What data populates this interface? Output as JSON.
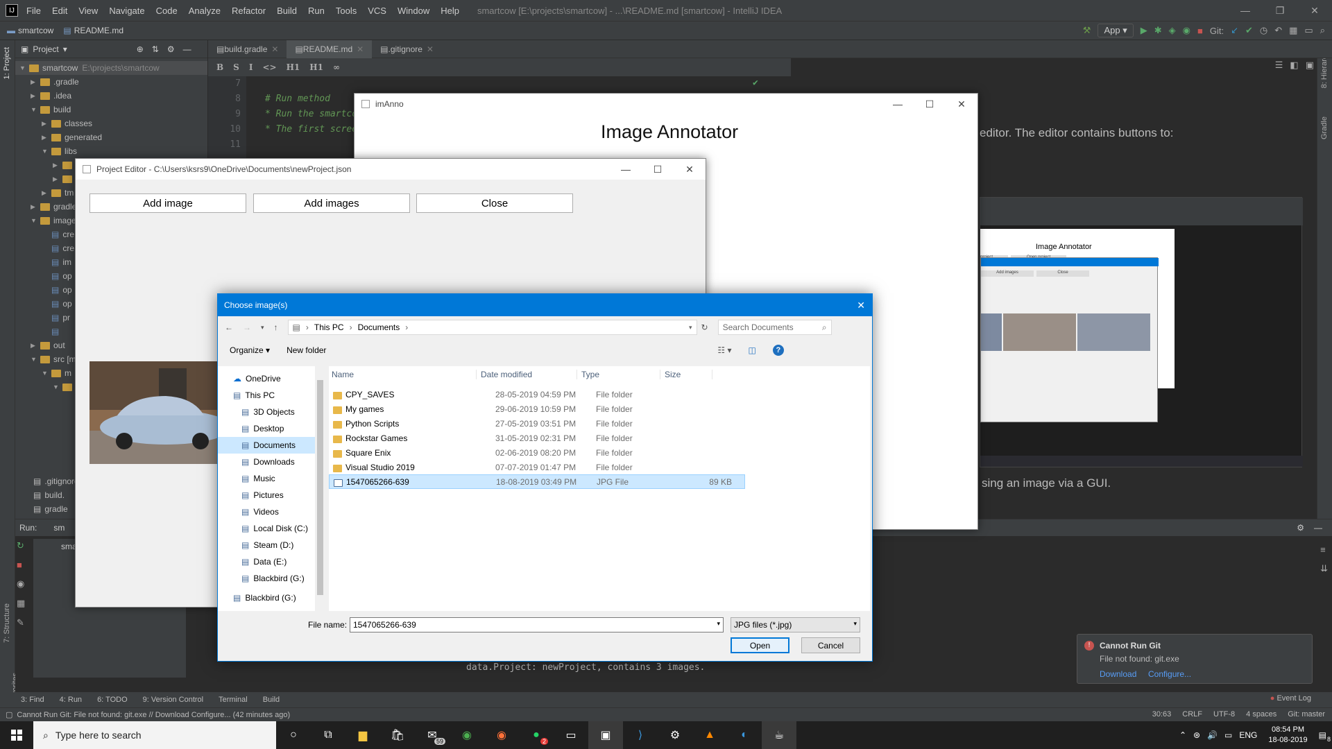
{
  "ide": {
    "menu": [
      "File",
      "Edit",
      "View",
      "Navigate",
      "Code",
      "Analyze",
      "Refactor",
      "Build",
      "Run",
      "Tools",
      "VCS",
      "Window",
      "Help"
    ],
    "window_title": "smartcow [E:\\projects\\smartcow] - ...\\README.md [smartcow] - IntelliJ IDEA",
    "breadcrumb": [
      "smartcow",
      "README.md"
    ],
    "run_config": "App",
    "git_label": "Git:",
    "project_panel_title": "Project",
    "tree": [
      {
        "label": "smartcow",
        "extra": "E:\\projects\\smartcow",
        "depth": 0,
        "open": true
      },
      {
        "label": ".gradle",
        "depth": 1,
        "open": false
      },
      {
        "label": ".idea",
        "depth": 1,
        "open": false
      },
      {
        "label": "build",
        "depth": 1,
        "open": true
      },
      {
        "label": "classes",
        "depth": 2,
        "open": false
      },
      {
        "label": "generated",
        "depth": 2,
        "open": false
      },
      {
        "label": "libs",
        "depth": 2,
        "open": true
      },
      {
        "label": "",
        "depth": 3,
        "open": false
      },
      {
        "label": "",
        "depth": 3,
        "open": false
      },
      {
        "label": "tm",
        "depth": 2,
        "open": false
      },
      {
        "label": "gradle",
        "depth": 1,
        "open": false
      },
      {
        "label": "image",
        "depth": 1,
        "open": true
      },
      {
        "label": "cre",
        "depth": 2,
        "file": true
      },
      {
        "label": "cre",
        "depth": 2,
        "file": true
      },
      {
        "label": "im",
        "depth": 2,
        "file": true
      },
      {
        "label": "op",
        "depth": 2,
        "file": true
      },
      {
        "label": "op",
        "depth": 2,
        "file": true
      },
      {
        "label": "op",
        "depth": 2,
        "file": true
      },
      {
        "label": "pr",
        "depth": 2,
        "file": true
      },
      {
        "label": "",
        "depth": 2,
        "file": true
      },
      {
        "label": "out",
        "depth": 1,
        "open": false
      },
      {
        "label": "src [m",
        "depth": 1,
        "open": true
      },
      {
        "label": "m",
        "depth": 2,
        "open": true
      },
      {
        "label": "",
        "depth": 3,
        "open": true
      }
    ],
    "tree_bottom": [
      ".gitignore",
      "build.",
      "gradle"
    ],
    "editor_tabs": [
      {
        "label": "build.gradle",
        "active": false
      },
      {
        "label": "README.md",
        "active": true
      },
      {
        "label": ".gitignore",
        "active": false
      }
    ],
    "md_toolbar": [
      "B",
      "S",
      "I",
      "<>",
      "H1",
      "H1",
      "∞"
    ],
    "code_lines": [
      {
        "num": "7",
        "text": ""
      },
      {
        "num": "8",
        "text": "# Run method"
      },
      {
        "num": "9",
        "text": "* Run the smartcow"
      },
      {
        "num": "10",
        "text": "* The first screen"
      },
      {
        "num": "11",
        "text": ""
      }
    ],
    "preview_text_1": "editor. The editor contains buttons to:",
    "preview_text_2": "sing an image via a GUI.",
    "run_label": "Run:",
    "run_tab": "sm",
    "run_item": "sma",
    "console_line": "data.Project: newProject, contains 3 images.",
    "bottom_tabs": [
      "3: Find",
      "4: Run",
      "6: TODO",
      "9: Version Control",
      "Terminal",
      "Build"
    ],
    "event_log": "Event Log",
    "status_msg": "Cannot Run Git: File not found: git.exe // Download   Configure... (42 minutes ago)",
    "status_right": [
      "30:63",
      "CRLF",
      "UTF-8",
      "4 spaces",
      "Git: master"
    ],
    "left_stripe": [
      "1: Project",
      "7: Structure",
      "2: Favorites"
    ],
    "right_stripe": [
      "8: Hierarchy",
      "Gradle"
    ]
  },
  "notification": {
    "title": "Cannot Run Git",
    "body": "File not found: git.exe",
    "links": [
      "Download",
      "Configure..."
    ]
  },
  "imanno": {
    "title": "imAnno",
    "heading": "Image Annotator"
  },
  "project_editor": {
    "title": "Project Editor - C:\\Users\\ksrs9\\OneDrive\\Documents\\newProject.json",
    "buttons": [
      "Add image",
      "Add images",
      "Close"
    ]
  },
  "dialog": {
    "title": "Choose image(s)",
    "path": [
      "This PC",
      "Documents"
    ],
    "search_placeholder": "Search Documents",
    "organize": "Organize",
    "new_folder": "New folder",
    "nav": [
      {
        "label": "OneDrive",
        "indent": 0
      },
      {
        "label": "This PC",
        "indent": 0
      },
      {
        "label": "3D Objects",
        "indent": 1
      },
      {
        "label": "Desktop",
        "indent": 1
      },
      {
        "label": "Documents",
        "indent": 1,
        "selected": true
      },
      {
        "label": "Downloads",
        "indent": 1
      },
      {
        "label": "Music",
        "indent": 1
      },
      {
        "label": "Pictures",
        "indent": 1
      },
      {
        "label": "Videos",
        "indent": 1
      },
      {
        "label": "Local Disk (C:)",
        "indent": 1
      },
      {
        "label": "Steam (D:)",
        "indent": 1
      },
      {
        "label": "Data (E:)",
        "indent": 1
      },
      {
        "label": "Blackbird (G:)",
        "indent": 1
      },
      {
        "label": "Blackbird (G:)",
        "indent": 0
      }
    ],
    "columns": [
      "Name",
      "Date modified",
      "Type",
      "Size"
    ],
    "files": [
      {
        "name": "CPY_SAVES",
        "date": "28-05-2019 04:59 PM",
        "type": "File folder",
        "size": ""
      },
      {
        "name": "My games",
        "date": "29-06-2019 10:59 PM",
        "type": "File folder",
        "size": ""
      },
      {
        "name": "Python Scripts",
        "date": "27-05-2019 03:51 PM",
        "type": "File folder",
        "size": ""
      },
      {
        "name": "Rockstar Games",
        "date": "31-05-2019 02:31 PM",
        "type": "File folder",
        "size": ""
      },
      {
        "name": "Square Enix",
        "date": "02-06-2019 08:20 PM",
        "type": "File folder",
        "size": ""
      },
      {
        "name": "Visual Studio 2019",
        "date": "07-07-2019 01:47 PM",
        "type": "File folder",
        "size": ""
      },
      {
        "name": "1547065266-639",
        "date": "18-08-2019 03:49 PM",
        "type": "JPG File",
        "size": "89 KB",
        "selected": true
      }
    ],
    "file_name_label": "File name:",
    "file_name_value": "1547065266-639",
    "filter": "JPG files (*.jpg)",
    "open": "Open",
    "cancel": "Cancel"
  },
  "embedded": {
    "heading": "Image Annotator",
    "btn1": "project",
    "btn2": "Open project",
    "btn3": "Add images",
    "btn4": "Close"
  },
  "taskbar": {
    "search": "Type here to search",
    "lang": "ENG",
    "time": "08:54 PM",
    "date": "18-08-2019",
    "badge_mail": "59",
    "badge_whatsapp": "2",
    "notif_count": "8"
  }
}
